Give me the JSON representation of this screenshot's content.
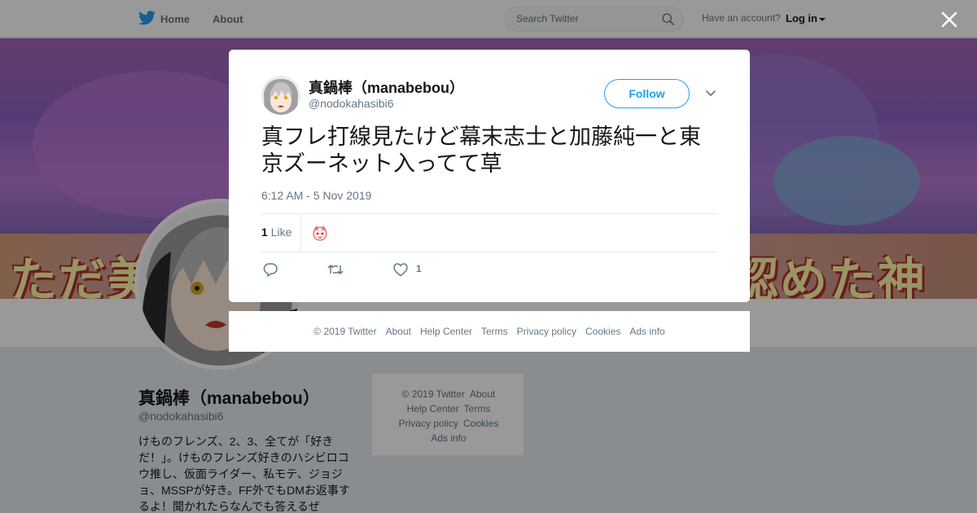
{
  "topbar": {
    "home_label": "Home",
    "about_label": "About",
    "search_placeholder": "Search Twitter",
    "account_prompt": "Have an account?",
    "login_label": "Log in"
  },
  "banner": {
    "left_text": "ただ美",
    "right_text": "認めた神"
  },
  "profile": {
    "name": "真鍋棒（manabebou）",
    "handle": "@nodokahasibi6",
    "bio": "けものフレンズ、2、3、全てが「好き だ！」。けものフレンズ好きのハシビロコウ推し、仮面ライダー、私モテ、ジョジョ、MSSPが好き。FF外でもDMお返事するよ！聞かれたらなんでも答えるぜ"
  },
  "side_footer": {
    "line1": [
      "© 2019 Twitter",
      "About"
    ],
    "line2": [
      "Help Center",
      "Terms"
    ],
    "line3": [
      "Privacy policy",
      "Cookies"
    ],
    "line4": [
      "Ads info"
    ]
  },
  "tweet": {
    "author_name": "真鍋棒（manabebou）",
    "author_handle": "@nodokahasibi6",
    "follow_label": "Follow",
    "text": "真フレ打線見たけど幕末志士と加藤純一と東京ズーネット入ってて草",
    "timestamp": "6:12 AM - 5 Nov 2019",
    "like_count": "1",
    "like_label": "Like",
    "action_like_count": "1"
  },
  "modal_footer": {
    "links": [
      "© 2019 Twitter",
      "About",
      "Help Center",
      "Terms",
      "Privacy policy",
      "Cookies",
      "Ads info"
    ]
  },
  "colors": {
    "accent": "#1da1f2",
    "muted_text": "#657786",
    "overlay": "rgba(0,0,0,0.4)"
  },
  "icons": [
    "twitter-bird-icon",
    "search-icon",
    "close-icon",
    "chevron-down-icon",
    "reply-icon",
    "retweet-icon",
    "heart-icon"
  ]
}
